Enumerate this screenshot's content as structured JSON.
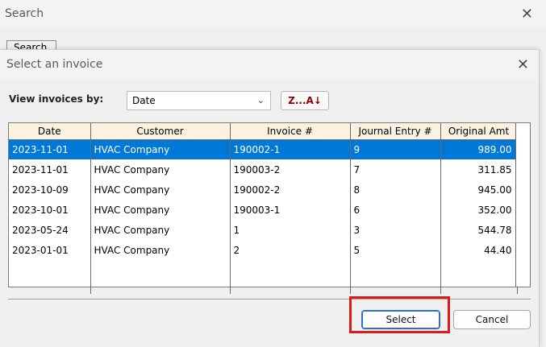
{
  "background_window": {
    "title": "Search",
    "tab_label": "Search"
  },
  "dialog": {
    "title": "Select an invoice",
    "view_label": "View invoices by:",
    "view_select_value": "Date",
    "sort_button_label": "Z...A↓",
    "columns": [
      "Date",
      "Customer",
      "Invoice #",
      "Journal Entry #",
      "Original Amt"
    ],
    "rows": [
      {
        "date": "2023-11-01",
        "customer": "HVAC Company",
        "invoice": "190002-1",
        "journal": "9",
        "amount": "989.00",
        "selected": true
      },
      {
        "date": "2023-11-01",
        "customer": "HVAC Company",
        "invoice": "190003-2",
        "journal": "7",
        "amount": "311.85",
        "selected": false
      },
      {
        "date": "2023-10-09",
        "customer": "HVAC Company",
        "invoice": "190002-2",
        "journal": "8",
        "amount": "945.00",
        "selected": false
      },
      {
        "date": "2023-10-01",
        "customer": "HVAC Company",
        "invoice": "190003-1",
        "journal": "6",
        "amount": "352.00",
        "selected": false
      },
      {
        "date": "2023-05-24",
        "customer": "HVAC Company",
        "invoice": "1",
        "journal": "3",
        "amount": "544.78",
        "selected": false
      },
      {
        "date": "2023-01-01",
        "customer": "HVAC Company",
        "invoice": "2",
        "journal": "5",
        "amount": "44.40",
        "selected": false
      }
    ],
    "select_button_label": "Select",
    "cancel_button_label": "Cancel"
  },
  "icons": {
    "close": "close-icon",
    "dropdown": "chevron-down-icon"
  },
  "colors": {
    "selection": "#0078d7",
    "header_bg": "#fbf2e2",
    "sort_text": "#8b0000",
    "highlight": "#e01919"
  }
}
